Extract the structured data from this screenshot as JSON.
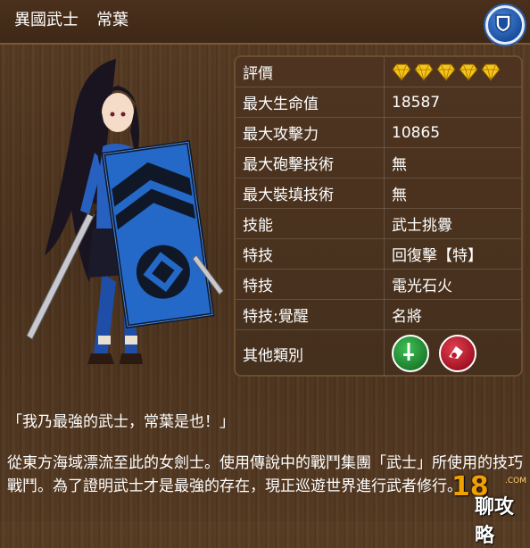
{
  "header": {
    "title": "異國武士",
    "name": "常葉",
    "shield_icon": "shield-icon"
  },
  "stats": {
    "rating": {
      "label": "評價",
      "stars": 5
    },
    "rows": [
      {
        "label": "最大生命值",
        "value": "18587"
      },
      {
        "label": "最大攻擊力",
        "value": "10865"
      },
      {
        "label": "最大砲擊技術",
        "value": "無"
      },
      {
        "label": "最大裝填技術",
        "value": "無"
      },
      {
        "label": "技能",
        "value": "武士挑釁"
      },
      {
        "label": "特技",
        "value": "回復擊【特】"
      },
      {
        "label": "特技",
        "value": "電光石火"
      },
      {
        "label": "特技:覺醒",
        "value": "名將"
      }
    ],
    "other": {
      "label": "其他類別",
      "icons": [
        "sword-icon",
        "cannon-icon"
      ]
    }
  },
  "quote": "「我乃最強的武士，常葉是也！」",
  "description": "從東方海域漂流至此的女劍士。使用傳說中的戰鬥集團「武士」所使用的技巧戰鬥。為了證明武士才是最強的存在，現正巡遊世界進行武者修行。",
  "watermark": {
    "num": "18",
    "text": "聊攻略",
    "sub": ".COM"
  },
  "colors": {
    "diamond": "#f5c518",
    "green": "#2a9a3a",
    "red": "#c01828",
    "shield_blue": "#1a4fa0"
  }
}
